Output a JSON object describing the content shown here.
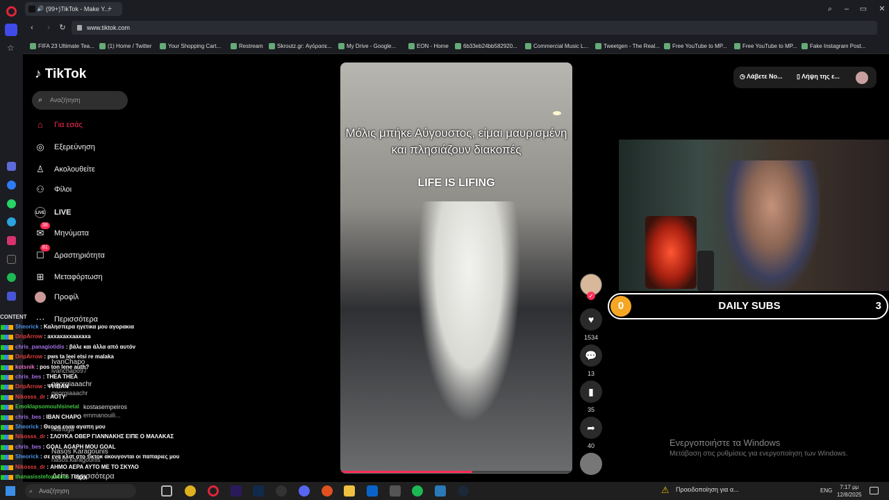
{
  "browser": {
    "tab_title": "(99+)TikTok - Make Y...",
    "url": "www.tiktok.com",
    "bookmarks": [
      "FIFA 23 Ultimate Tea...",
      "(1) Home / Twitter",
      "Your Shopping Cart...",
      "Restream",
      "Skroutz.gr: Αγόρασε...",
      "My Drive - Google...",
      "EON - Home",
      "6b33eb24bb582920...",
      "Commercial Music L...",
      "Tweetgen - The Real...",
      "Free YouTube to MP...",
      "Free YouTube to MP...",
      "Fake Instagram Post..."
    ]
  },
  "tiktok": {
    "logo": "TikTok",
    "search_placeholder": "Αναζήτηση",
    "nav": [
      {
        "label": "Για εσάς",
        "icon": "home-icon"
      },
      {
        "label": "Εξερεύνηση",
        "icon": "compass-icon"
      },
      {
        "label": "Ακολουθείτε",
        "icon": "following-icon"
      },
      {
        "label": "Φίλοι",
        "icon": "friends-icon"
      },
      {
        "label": "LIVE",
        "icon": "live-icon"
      },
      {
        "label": "Μηνύματα",
        "icon": "messages-icon",
        "badge": "38"
      },
      {
        "label": "Δραστηριότητα",
        "icon": "activity-icon",
        "badge": "81"
      },
      {
        "label": "Μεταφόρτωση",
        "icon": "upload-icon"
      },
      {
        "label": "Προφίλ",
        "icon": "profile-icon"
      },
      {
        "label": "Περισσότερα",
        "icon": "more-icon"
      }
    ],
    "caption": "Μόλις μπήκε Αύγουστος, είμαι μαυρισμένη και πλησιάζουν διακοπές",
    "caption2": "LIFE IS LIFING",
    "likes": "1534",
    "comments": "13",
    "saves": "35",
    "shares": "40",
    "top_btn1": "Λάβετε Νο...",
    "top_btn2": "Λήψη της ε...",
    "following_accounts": [
      "IvanChapo",
      "ivanchapo97",
      "georgiaaachr",
      "georgiaaachr",
      "kostasempeiros",
      "emmanouili...",
      "mariuga",
      "Nasos Karagounis",
      "nasos.karagounis",
      "Δείτε περισσότερα"
    ]
  },
  "overlay": {
    "subs_left": "0",
    "subs_title": "DAILY SUBS",
    "subs_right": "3"
  },
  "chat": [
    {
      "user": "Sheorick",
      "msg": "Καλησπερα ηγετικα μου αγορακια",
      "color": "#4a90e2"
    },
    {
      "user": "DripArrow",
      "msg": "axxaxaxxaaxaxa",
      "color": "#e04040"
    },
    {
      "user": "chris_panagiotidis",
      "msg": "βάλε και άλλα από αυτόν",
      "color": "#a070e0"
    },
    {
      "user": "DripArrow",
      "msg": "pws ta leei etsi re malaka",
      "color": "#e04040"
    },
    {
      "user": "kotsnik",
      "msg": "pos ton lene auth?",
      "color": "#e070c0"
    },
    {
      "user": "chris_bes",
      "msg": "THEA THEA",
      "color": "#a070e0"
    },
    {
      "user": "DripArrow",
      "msg": "ΨΙ ΙΒΑΝ",
      "color": "#e04040"
    },
    {
      "user": "Nikosss_dr",
      "msg": "ΑΟΤΥ",
      "color": "#e04040"
    },
    {
      "user": "Emoklapsomouhlsinetal",
      "msg": "",
      "color": "#40c040"
    },
    {
      "user": "chris_bes",
      "msg": "ΙΒΑΝ CHAPO",
      "color": "#a070e0"
    },
    {
      "user": "Sheorick",
      "msg": "Θεορα ειναι αγαπη μου",
      "color": "#4a90e2"
    },
    {
      "user": "Nikosss_dr",
      "msg": "ΣΛΟΥΚΑ ΟΒΕΡ ΓΙΑΝΝΑΚΗΣ ΕΙΠΕ Ο ΜΑΛΑΚΑΣ",
      "color": "#e04040"
    },
    {
      "user": "chris_bes",
      "msg": "GOAL AGAPH MOU GOAL",
      "color": "#a070e0"
    },
    {
      "user": "Sheorick",
      "msg": "σε ενα κλιπ στο τικτοκ ακουγονται οι παπαριες μου",
      "color": "#4a90e2"
    },
    {
      "user": "Nikosss_dr",
      "msg": "ΑΗΜΟ ΑΕΡΑ ΑΥΤΟ ΜΕ ΤΟ ΣΚΥΛΟ",
      "color": "#e04040"
    },
    {
      "user": "thanasisstefopoulos",
      "msg": "οχχχ",
      "color": "#40c040"
    }
  ],
  "chat_header": "CONTENT",
  "windows": {
    "activate_title": "Ενεργοποιήστε τα Windows",
    "activate_sub": "Μετάβαση στις ρυθμίσεις για ενεργοποίηση των Windows.",
    "search": "Αναζήτηση",
    "warning": "Προειδοποίηση για α...",
    "lang": "ENG",
    "time": "7:17 μμ",
    "date": "12/8/2025"
  }
}
